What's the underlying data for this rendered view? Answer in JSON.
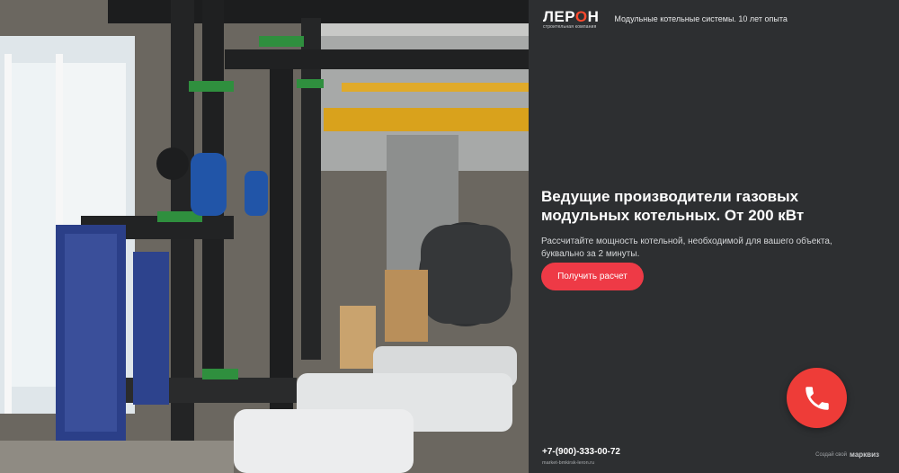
{
  "brand": {
    "name_prefix": "ЛЕР",
    "name_accent": "О",
    "name_suffix": "Н",
    "subtitle": "строительная компания",
    "accent_color": "#ff4a2e"
  },
  "header": {
    "tagline": "Модульные котельные системы. 10 лет опыта"
  },
  "hero": {
    "title": "Ведущие производители газовых модульных котельных. От 200 кВт",
    "description": "Рассчитайте мощность котельной, необходимой для вашего объекта, буквально за 2 минуты.",
    "cta_label": "Получить расчет",
    "cta_color": "#ee3a46"
  },
  "footer": {
    "phone": "+7-(900)-333-00-72",
    "domain": "market-bmkirsk-leron.ru",
    "made_with": "Создай свой",
    "made_with_brand": "марквиз"
  },
  "call_button": {
    "icon": "phone-icon",
    "color": "#ee3c38"
  }
}
